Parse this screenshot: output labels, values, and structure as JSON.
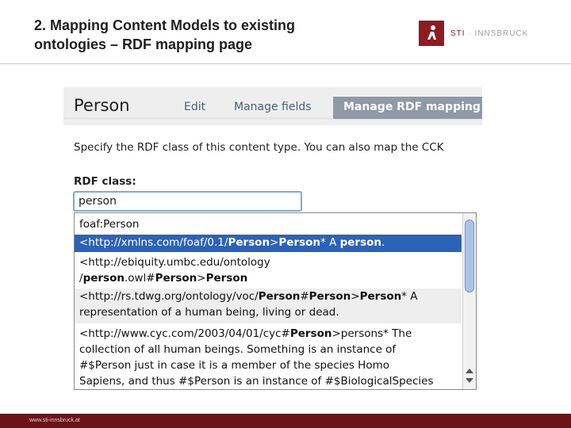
{
  "slide": {
    "title_line1": "2. Mapping Content Models to existing",
    "title_line2": "ontologies – RDF mapping page",
    "logo_brand": "STI",
    "logo_sep": " · ",
    "logo_place": "INNSBRUCK",
    "footer_url": "www.sti-innsbruck.at",
    "colors": {
      "brand": "#8c1c22",
      "footer": "#6a1418",
      "selection": "#2c63b6",
      "active_tab": "#8f99a7"
    }
  },
  "screenshot": {
    "page_title": "Person",
    "tabs": [
      {
        "label": "Edit",
        "active": false
      },
      {
        "label": "Manage fields",
        "active": false
      },
      {
        "label": "Manage RDF mapping",
        "active": true
      }
    ],
    "description": "Specify the RDF class of this content type. You can also map the CCK",
    "rdf_class_label": "RDF class:",
    "rdf_class_value": "person",
    "suggestions": [
      {
        "parts": [
          "foaf:Person"
        ]
      },
      {
        "parts": [
          "<http://xmlns.com/foaf/0.1/",
          "Person",
          ">",
          "Person",
          "* A ",
          "person",
          "."
        ]
      },
      {
        "parts": [
          "<http://ebiquity.umbc.edu/ontology",
          "/",
          "person",
          ".owl#",
          "Person",
          ">",
          "Person"
        ]
      },
      {
        "parts": [
          "<http://rs.tdwg.org/ontology/voc/",
          "Person",
          "#",
          "Person",
          ">",
          "Person",
          "* A",
          "representation of a human being, living or dead."
        ]
      },
      {
        "parts": [
          "<http://www.cyc.com/2003/04/01/cyc#",
          "Person",
          ">persons* The",
          "collection of all human beings. Something is an instance of",
          "#$Person just in case it is a member of the species Homo",
          "Sapiens, and thus #$Person is an instance of #$BiologicalSpecies"
        ]
      }
    ]
  }
}
